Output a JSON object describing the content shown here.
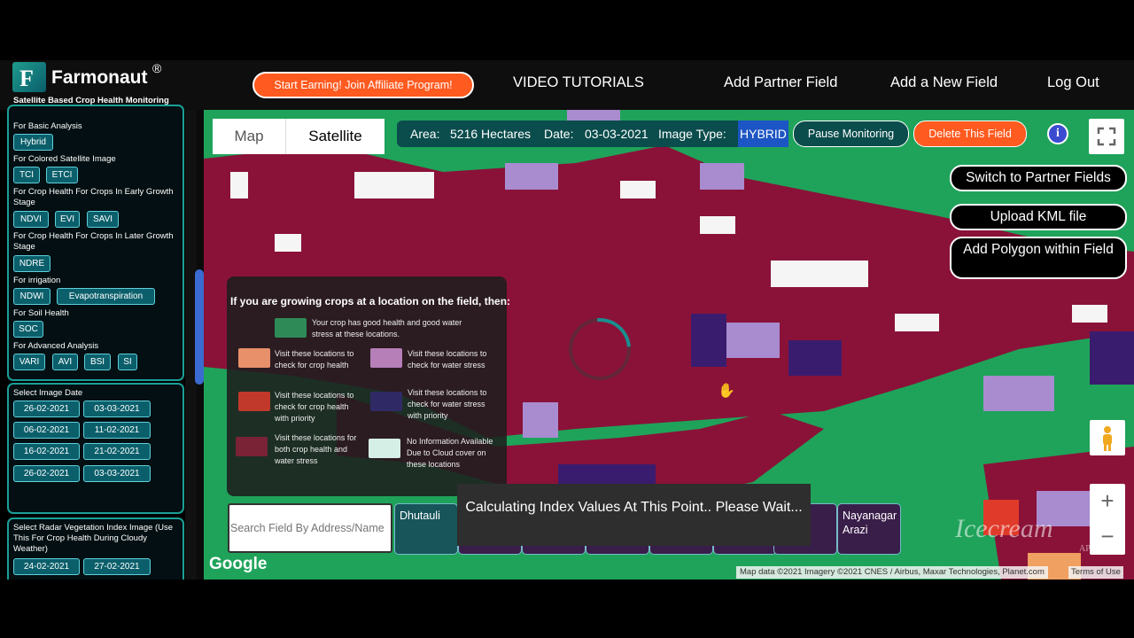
{
  "header": {
    "brand": "Farmonaut",
    "registered": "®",
    "logo_letter": "F",
    "tagline": "Satellite Based Crop Health Monitoring",
    "affiliate_label": "Start Earning! Join Affiliate Program!",
    "nav": [
      "VIDEO TUTORIALS",
      "Add Partner Field",
      "Add a New Field",
      "Log Out"
    ]
  },
  "sidebar": {
    "basic_label": "For Basic Analysis",
    "basic": [
      "Hybrid"
    ],
    "colored_label": "For Colored Satellite Image",
    "colored": [
      "TCI",
      "ETCI"
    ],
    "early_label": "For Crop Health For Crops In Early Growth Stage",
    "early": [
      "NDVI",
      "EVI",
      "SAVI"
    ],
    "later_label": "For Crop Health For Crops In Later Growth Stage",
    "later": [
      "NDRE"
    ],
    "irrigation_label": "For irrigation",
    "irrigation": [
      "NDWI",
      "Evapotranspiration"
    ],
    "soil_label": "For Soil Health",
    "soil": [
      "SOC"
    ],
    "advanced_label": "For Advanced Analysis",
    "advanced": [
      "VARI",
      "AVI",
      "BSI",
      "SI"
    ],
    "date_label": "Select Image Date",
    "dates": [
      "26-02-2021",
      "03-03-2021",
      "06-02-2021",
      "11-02-2021",
      "16-02-2021",
      "21-02-2021",
      "26-02-2021",
      "03-03-2021"
    ],
    "radar_label": "Select Radar Vegetation Index Image (Use This For Crop Health During Cloudy Weather)",
    "radar_dates": [
      "24-02-2021",
      "27-02-2021"
    ]
  },
  "map": {
    "map_tab": "Map",
    "satellite_tab": "Satellite",
    "area_label": "Area:",
    "area_value": "5216 Hectares",
    "date_label": "Date:",
    "date_value": "03-03-2021",
    "image_type_label": "Image Type:",
    "image_type_value": "HYBRID",
    "pause_label": "Pause Monitoring",
    "delete_label": "Delete This Field",
    "info_icon": "i",
    "switch_partner": "Switch to Partner Fields",
    "upload_kml": "Upload KML file",
    "add_polygon": "Add Polygon within Field",
    "search_placeholder": "Search Field By Address/Name",
    "field_cards": [
      "Dhutauli",
      "Nayanagar Arazi"
    ],
    "toast": "Calculating Index Values At This Point.. Please Wait...",
    "google": "Google",
    "attribution": "Map data ©2021 Imagery ©2021 CNES / Airbus, Maxar Technologies, Planet.com",
    "terms": "Terms of Use",
    "zoom_in": "+",
    "zoom_out": "−",
    "watermark": "Icecream",
    "watermark_sub": "APPS"
  },
  "legend": {
    "title": "If you are growing crops at a location on the field, then:",
    "items": [
      {
        "color": "#2e8b57",
        "text": "Your crop has good health and good water stress at these locations."
      },
      {
        "color": "#e8906a",
        "text": "Visit these locations to check for crop health"
      },
      {
        "color": "#b67fb8",
        "text": "Visit these locations to check for water stress"
      },
      {
        "color": "#c0392b",
        "text": "Visit these locations to check for crop health with priority"
      },
      {
        "color": "#2f2a66",
        "text": "Visit these locations to check for water stress with priority"
      },
      {
        "color": "#7a2236",
        "text": "Visit these locations for both crop health and water stress"
      },
      {
        "color": "#d6efe6",
        "text": "No Information Available Due to Cloud cover on these locations"
      }
    ]
  },
  "colors": {
    "accent_teal": "#1b9f97",
    "orange": "#ff5a1f",
    "field_green": "#1fa35a",
    "field_maroon": "#8a1238",
    "field_lilac": "#a98bd0",
    "field_indigo": "#3a1c6e"
  }
}
